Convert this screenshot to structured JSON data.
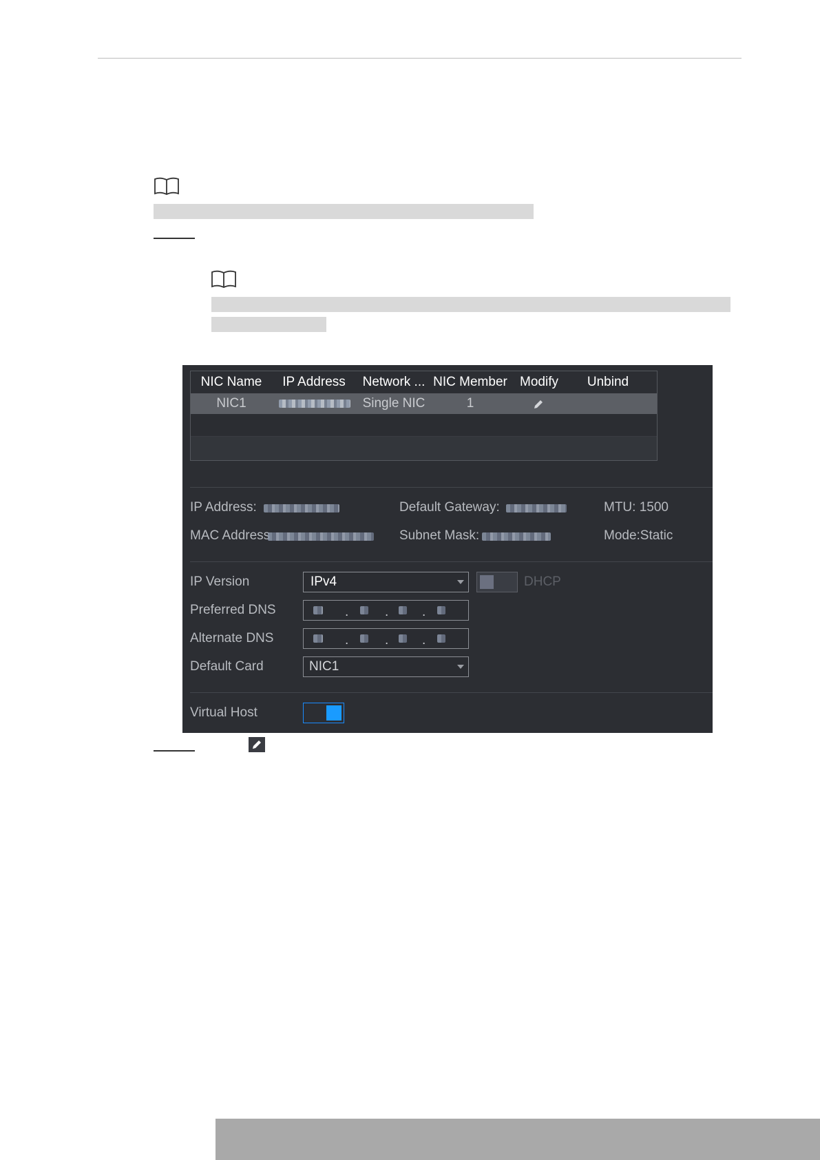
{
  "table": {
    "headers": [
      "NIC Name",
      "IP Address",
      "Network ...",
      "NIC Member",
      "Modify",
      "Unbind"
    ],
    "row": {
      "nic_name": "NIC1",
      "network_mode": "Single NIC",
      "nic_member": "1"
    }
  },
  "info": {
    "ip_address_label": "IP Address:",
    "default_gateway_label": "Default Gateway:",
    "mtu": "MTU: 1500",
    "mac_address_label": "MAC Address",
    "subnet_mask_label": "Subnet Mask:",
    "mode": "Mode:Static"
  },
  "form": {
    "ip_version_label": "IP Version",
    "ip_version_value": "IPv4",
    "dhcp_label": "DHCP",
    "dhcp_enabled": false,
    "preferred_dns_label": "Preferred DNS",
    "alternate_dns_label": "Alternate DNS",
    "default_card_label": "Default Card",
    "default_card_value": "NIC1",
    "virtual_host_label": "Virtual Host",
    "virtual_host_enabled": true
  },
  "icons": [
    "book-icon",
    "pencil-icon",
    "chevron-down-icon"
  ],
  "colors": {
    "panel_bg": "#2c2e33",
    "accent": "#1a9bff",
    "selected_row": "#5c5f65"
  }
}
